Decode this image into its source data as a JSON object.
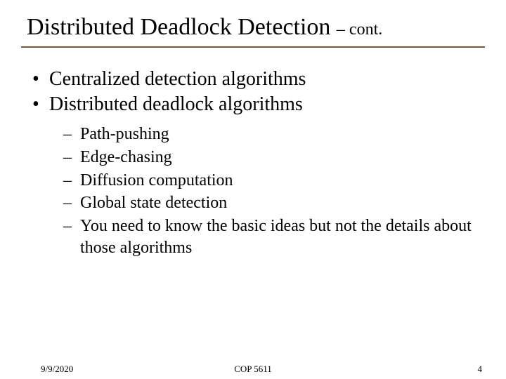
{
  "title": {
    "main": "Distributed Deadlock Detection ",
    "sub": "– cont."
  },
  "bullets": [
    {
      "text": "Centralized detection algorithms"
    },
    {
      "text": "Distributed deadlock algorithms",
      "sub": [
        "Path-pushing",
        "Edge-chasing",
        "Diffusion computation",
        "Global state detection",
        "You need to know the basic ideas but not the details about those algorithms"
      ]
    }
  ],
  "footer": {
    "date": "9/9/2020",
    "course": "COP 5611",
    "page": "4"
  }
}
